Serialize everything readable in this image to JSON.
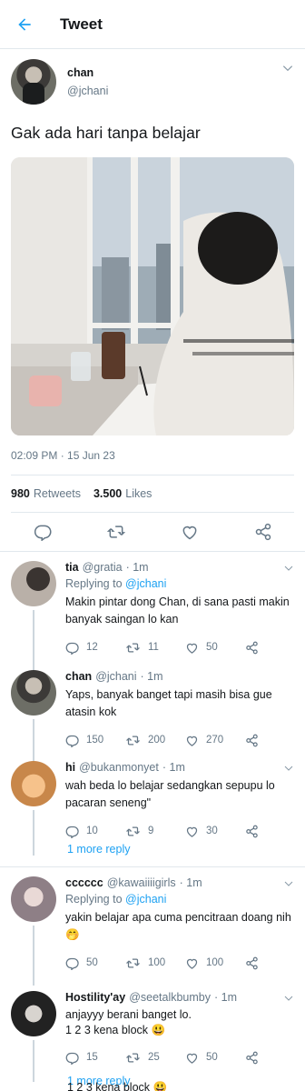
{
  "header": {
    "title": "Tweet"
  },
  "tweet": {
    "name": "chan",
    "handle": "@jchani",
    "text": "Gak ada hari tanpa belajar",
    "timestamp": "02:09 PM · 15 Jun 23",
    "retweets_count": "980",
    "retweets_label": "Retweets",
    "likes_count": "3.500",
    "likes_label": "Likes"
  },
  "replies": [
    {
      "name": "tia",
      "handle": "@gratia",
      "time": "· 1m",
      "replying_prefix": "Replying to",
      "replying_to": "@jchani",
      "text": "Makin pintar dong Chan, di sana pasti makin banyak saingan lo kan",
      "reply_count": "12",
      "retweet_count": "11",
      "like_count": "50"
    },
    {
      "name": "chan",
      "handle": "@jchani",
      "time": "· 1m",
      "text": "Yaps, banyak banget tapi masih bisa gue atasin kok",
      "reply_count": "150",
      "retweet_count": "200",
      "like_count": "270"
    },
    {
      "name": "hi",
      "handle": "@bukanmonyet",
      "time": "· 1m",
      "text": "wah beda lo belajar sedangkan sepupu lo pacaran seneng\"",
      "reply_count": "10",
      "retweet_count": "9",
      "like_count": "30"
    },
    {
      "name": "cccccc",
      "handle": "@kawaiiiigirls",
      "time": "· 1m",
      "replying_prefix": "Replying to",
      "replying_to": "@jchani",
      "text": "yakin belajar apa cuma pencitraan doang nih 🤭",
      "reply_count": "50",
      "retweet_count": "100",
      "like_count": "100"
    },
    {
      "name": "Hostility'ay",
      "handle": "@seetalkbumby",
      "time": "· 1m",
      "text_line1": "anjayyy berani banget lo.",
      "text_line2": "1 2 3 kena block 😃",
      "reply_count": "15",
      "retweet_count": "25",
      "like_count": "50"
    }
  ],
  "more_reply_1": "1 more reply",
  "more_reply_2": "1 more reply",
  "cut_off_text": "1 2 3 kena block 😃",
  "colors": {
    "accent": "#1da1f2",
    "secondary_text": "#657786",
    "divider": "#e1e8ed"
  }
}
